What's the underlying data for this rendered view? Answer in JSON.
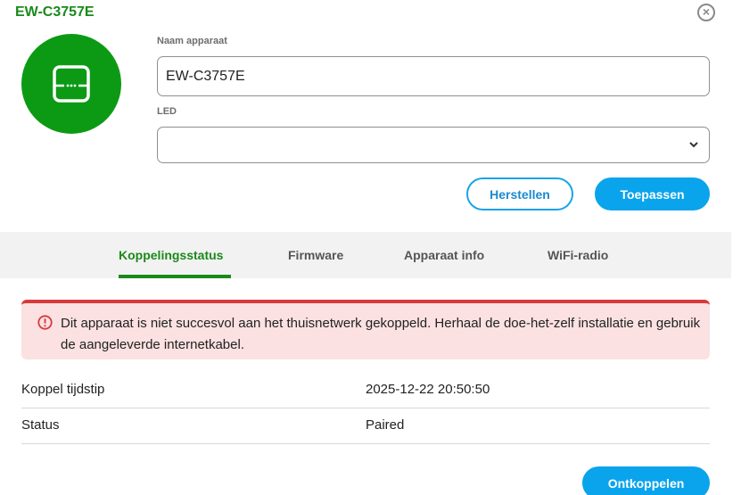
{
  "header": {
    "title": "EW-C3757E",
    "close_icon": "close-icon"
  },
  "device": {
    "icon": "router-icon",
    "accent": "#0c9a15"
  },
  "form": {
    "name_label": "Naam apparaat",
    "name_value": "EW-C3757E",
    "led_label": "LED",
    "led_value": "",
    "reset_label": "Herstellen",
    "apply_label": "Toepassen"
  },
  "tabs": [
    {
      "label": "Koppelingsstatus",
      "active": true
    },
    {
      "label": "Firmware",
      "active": false
    },
    {
      "label": "Apparaat info",
      "active": false
    },
    {
      "label": "WiFi-radio",
      "active": false
    }
  ],
  "alert": {
    "icon": "error-icon",
    "text": "Dit apparaat is niet succesvol aan het thuisnetwerk gekoppeld. Herhaal de doe-het-zelf installatie en gebruik de aangeleverde internetkabel."
  },
  "details": [
    {
      "key": "Koppel tijdstip",
      "value": "2025-12-22 20:50:50"
    },
    {
      "key": "Status",
      "value": "Paired"
    }
  ],
  "actions": {
    "unpair_label": "Ontkoppelen"
  },
  "colors": {
    "brand_green": "#1a8a1a",
    "primary_blue": "#0aa4ec",
    "error_red": "#d83a3a",
    "error_bg": "#fbe1e1"
  }
}
